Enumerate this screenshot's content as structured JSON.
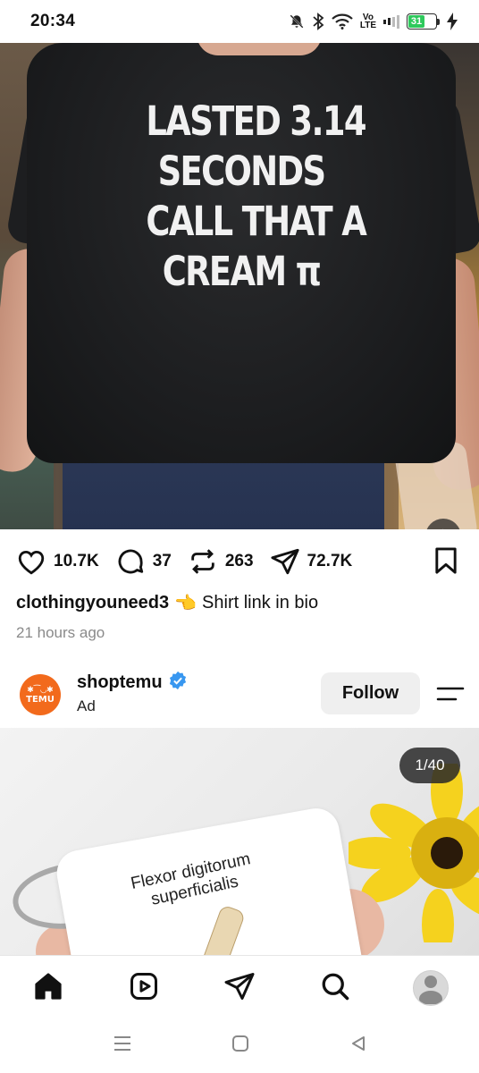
{
  "status_bar": {
    "time": "20:34",
    "volte_label": "Vo\nLTE",
    "battery_level": "31",
    "icons": [
      "mute-icon",
      "bluetooth-icon",
      "wifi-icon",
      "volte-icon",
      "signal-icon",
      "battery-icon",
      "charging-icon"
    ]
  },
  "post": {
    "shirt_text": [
      "LASTED 3.14",
      "SECONDS",
      "CALL THAT A",
      "CREAM π"
    ],
    "likes": "10.7K",
    "comments": "37",
    "reposts": "263",
    "shares": "72.7K",
    "caption_user": "clothingyouneed3",
    "caption_emoji": "👈",
    "caption_text": "Shirt link in bio",
    "timestamp": "21 hours ago"
  },
  "ad": {
    "account_name": "shoptemu",
    "label": "Ad",
    "avatar_glyphs": "✱⁀◡✱",
    "avatar_word": "TEMU",
    "follow_label": "Follow",
    "slide_counter": "1/40",
    "card_text": "Flexor digitorum superficialis"
  },
  "colors": {
    "accent_verified": "#3897f0",
    "temu_orange": "#f26a1c",
    "battery_green": "#2ec95c"
  },
  "bottom_nav": [
    "home-icon",
    "reels-icon",
    "messages-icon",
    "search-icon",
    "profile-avatar"
  ],
  "system_nav": [
    "recents-icon",
    "home-button-icon",
    "back-icon"
  ]
}
